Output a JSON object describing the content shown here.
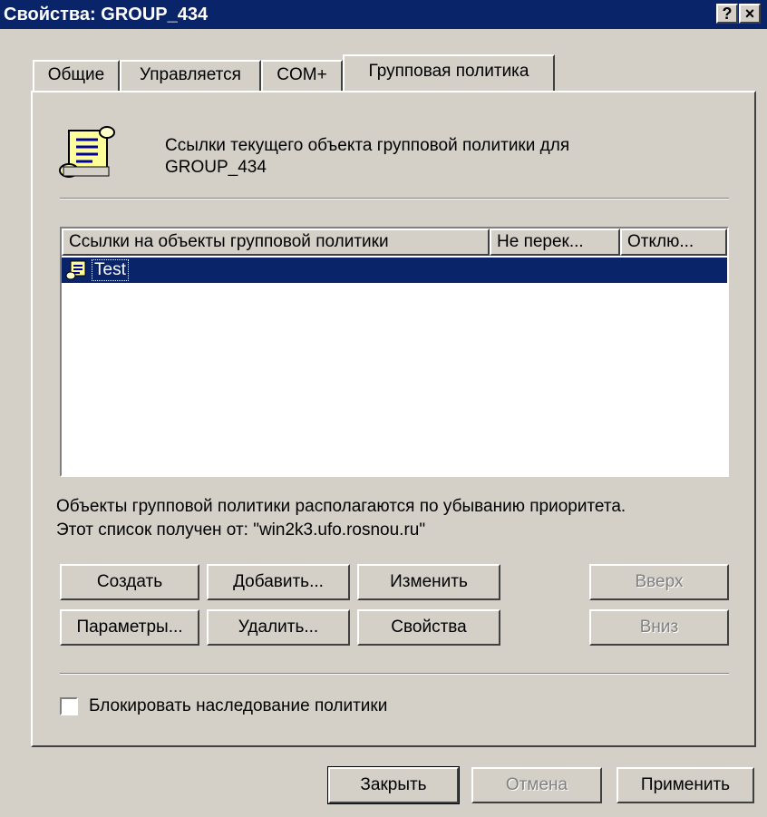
{
  "window": {
    "title": "Свойства: GROUP_434",
    "help_label": "?",
    "close_label": "×"
  },
  "tabs": [
    {
      "label": "Общие",
      "active": false
    },
    {
      "label": "Управляется",
      "active": false
    },
    {
      "label": "COM+",
      "active": false
    },
    {
      "label": "Групповая политика",
      "active": true
    }
  ],
  "header": {
    "line1": "Ссылки текущего объекта групповой политики для",
    "line2": "GROUP_434",
    "icon": "gpo-scroll-icon"
  },
  "list": {
    "columns": [
      "Ссылки на объекты групповой политики",
      "Не перек...",
      "Отклю..."
    ],
    "rows": [
      {
        "name": "Test",
        "no_override": "",
        "disabled": "",
        "selected": true
      }
    ],
    "selection_color": "#0a246a"
  },
  "info": {
    "line1": "Объекты групповой политики располагаются по убыванию приоритета.",
    "line2": "Этот список получен от: \"win2k3.ufo.rosnou.ru\""
  },
  "buttons": {
    "create": "Создать",
    "add": "Добавить...",
    "edit": "Изменить",
    "up": "Вверх",
    "options": "Параметры...",
    "delete": "Удалить...",
    "properties": "Свойства",
    "down": "Вниз"
  },
  "block_inheritance": {
    "label": "Блокировать наследование политики",
    "checked": false
  },
  "footer": {
    "close": "Закрыть",
    "cancel": "Отмена",
    "apply": "Применить"
  },
  "colors": {
    "titlebar": "#0a246a",
    "face": "#d4d0c8",
    "disabled_text": "#808080"
  }
}
